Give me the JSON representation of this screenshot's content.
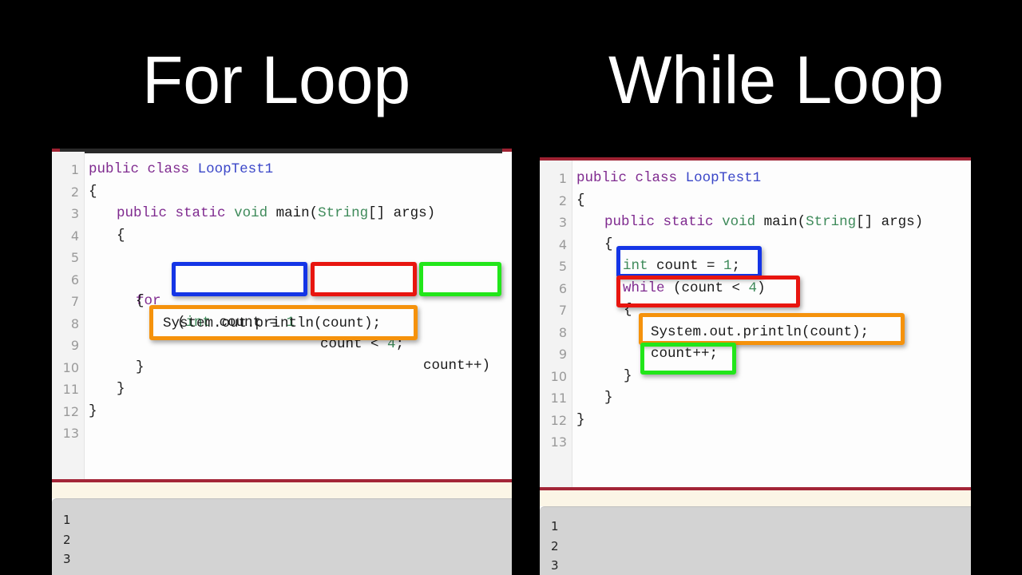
{
  "titles": {
    "left": "For Loop",
    "right": "While Loop"
  },
  "colors": {
    "keyword": "#7f2a8f",
    "type": "#3e8a5a",
    "class_name": "#3a46c8",
    "highlight_init": "#1435e6",
    "highlight_condition": "#e8150f",
    "highlight_update": "#22e61a",
    "highlight_body": "#f5920c"
  },
  "for_panel": {
    "line_numbers": [
      "1",
      "2",
      "3",
      "4",
      "5",
      "6",
      "7",
      "8",
      "9",
      "10",
      "11",
      "12",
      "13"
    ],
    "lines": [
      {
        "kw1": "public",
        "kw2": "class",
        "name": "LoopTest1"
      },
      {
        "text": "{"
      },
      {
        "kw1": "public",
        "kw2": "static",
        "ty": "void",
        "text": "main(",
        "ty2": "String",
        "text2": "[] args)"
      },
      {
        "text": "{"
      },
      {
        "text": ""
      },
      {
        "kw": "for",
        "open": "(",
        "ty": "int",
        "init_rest": "count = ",
        "init_val": "1",
        "cond": "count < ",
        "cond_val": "4",
        "semi": ";",
        "update": "count++)"
      },
      {
        "text": "{"
      },
      {
        "text": "System.out.println(count);"
      },
      {
        "text": ""
      },
      {
        "text": "}"
      },
      {
        "text": "}"
      },
      {
        "text": "}"
      },
      {
        "text": ""
      }
    ],
    "output": [
      "1",
      "2",
      "3"
    ]
  },
  "while_panel": {
    "line_numbers": [
      "1",
      "2",
      "3",
      "4",
      "5",
      "6",
      "7",
      "8",
      "9",
      "10",
      "11",
      "12",
      "13"
    ],
    "lines": [
      {
        "kw1": "public",
        "kw2": "class",
        "name": "LoopTest1"
      },
      {
        "text": "{"
      },
      {
        "kw1": "public",
        "kw2": "static",
        "ty": "void",
        "text": "main(",
        "ty2": "String",
        "text2": "[] args)"
      },
      {
        "text": "{"
      },
      {
        "ty": "int",
        "rest": " count = ",
        "val": "1",
        "end": ";"
      },
      {
        "kw": "while",
        "rest": " (count < ",
        "val": "4",
        "end": ")"
      },
      {
        "text": "{"
      },
      {
        "text": "System.out.println(count);"
      },
      {
        "text": "count++;"
      },
      {
        "text": "}"
      },
      {
        "text": "}"
      },
      {
        "text": "}"
      },
      {
        "text": ""
      }
    ],
    "output": [
      "1",
      "2",
      "3"
    ]
  }
}
